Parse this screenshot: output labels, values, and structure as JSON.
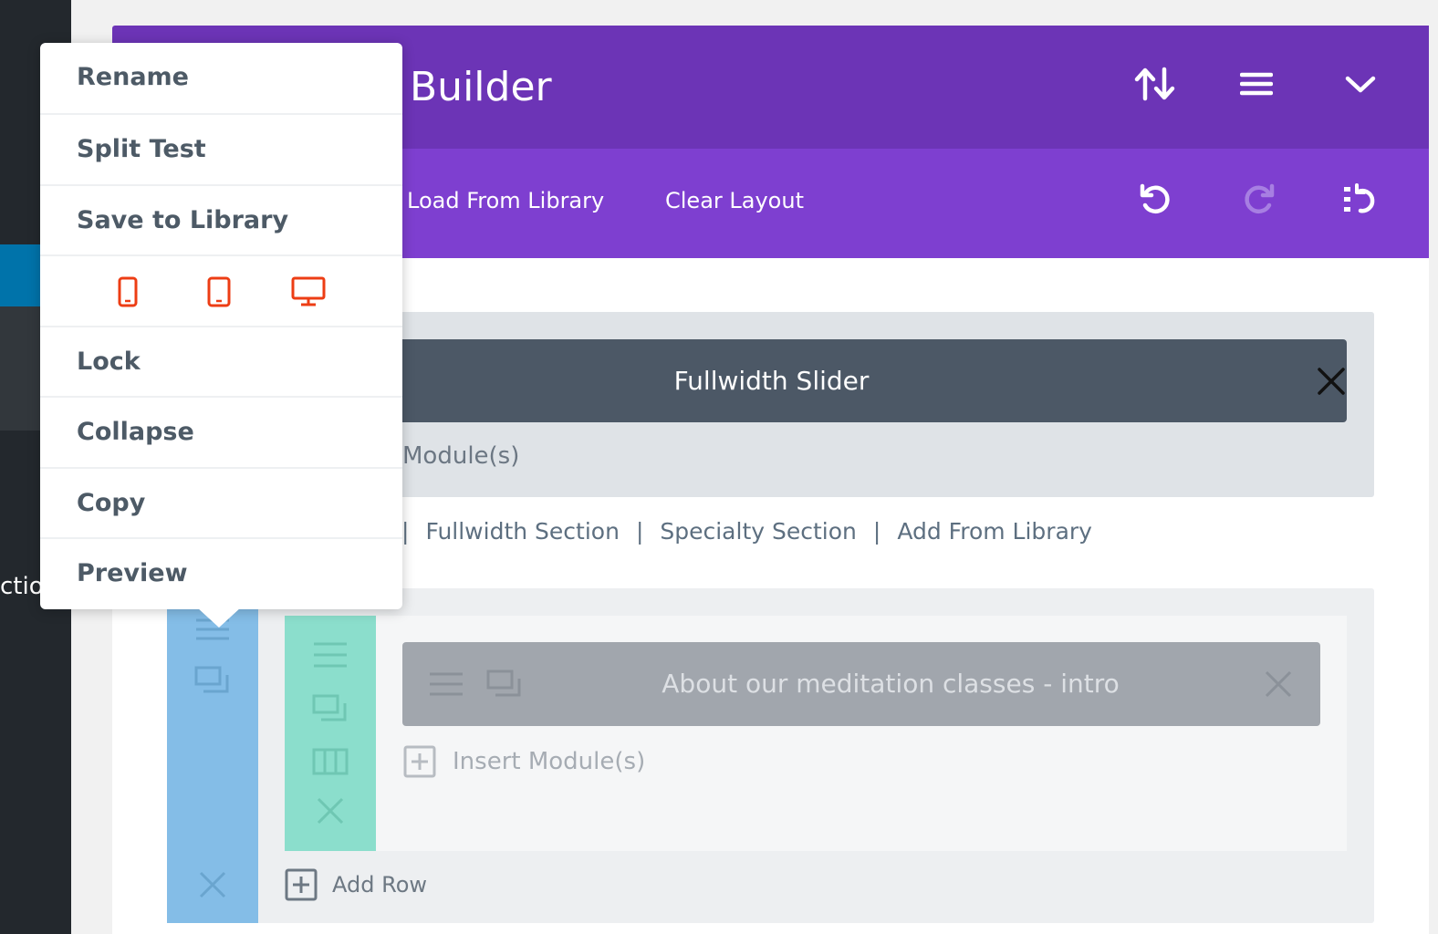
{
  "sidebar": {
    "partial_label": "ctio"
  },
  "header": {
    "title": "Builder"
  },
  "toolbar": {
    "load_from_library": "Load From Library",
    "clear_layout": "Clear Layout"
  },
  "section1": {
    "module_title": "Fullwidth Slider",
    "insert_label": "Module(s)"
  },
  "add_links": [
    "Fullwidth Section",
    "Specialty Section",
    "Add From Library"
  ],
  "section2": {
    "module_title": "About our meditation classes - intro",
    "insert_module_label": "Insert Module(s)",
    "add_row_label": "Add Row"
  },
  "context_menu": {
    "items_top": [
      "Rename",
      "Split Test",
      "Save to Library"
    ],
    "device_icons": [
      "phone-icon",
      "tablet-icon",
      "desktop-icon"
    ],
    "items_bottom": [
      "Lock",
      "Collapse",
      "Copy",
      "Preview"
    ]
  },
  "colors": {
    "header": "#6c34b6",
    "toolbar": "#7e3fd0",
    "section_handle": "#84bde7",
    "row_handle": "#8bdecc",
    "slider_module": "#4c5866",
    "text_module": "#a1a6ad",
    "device_icon": "#ed3d14"
  }
}
